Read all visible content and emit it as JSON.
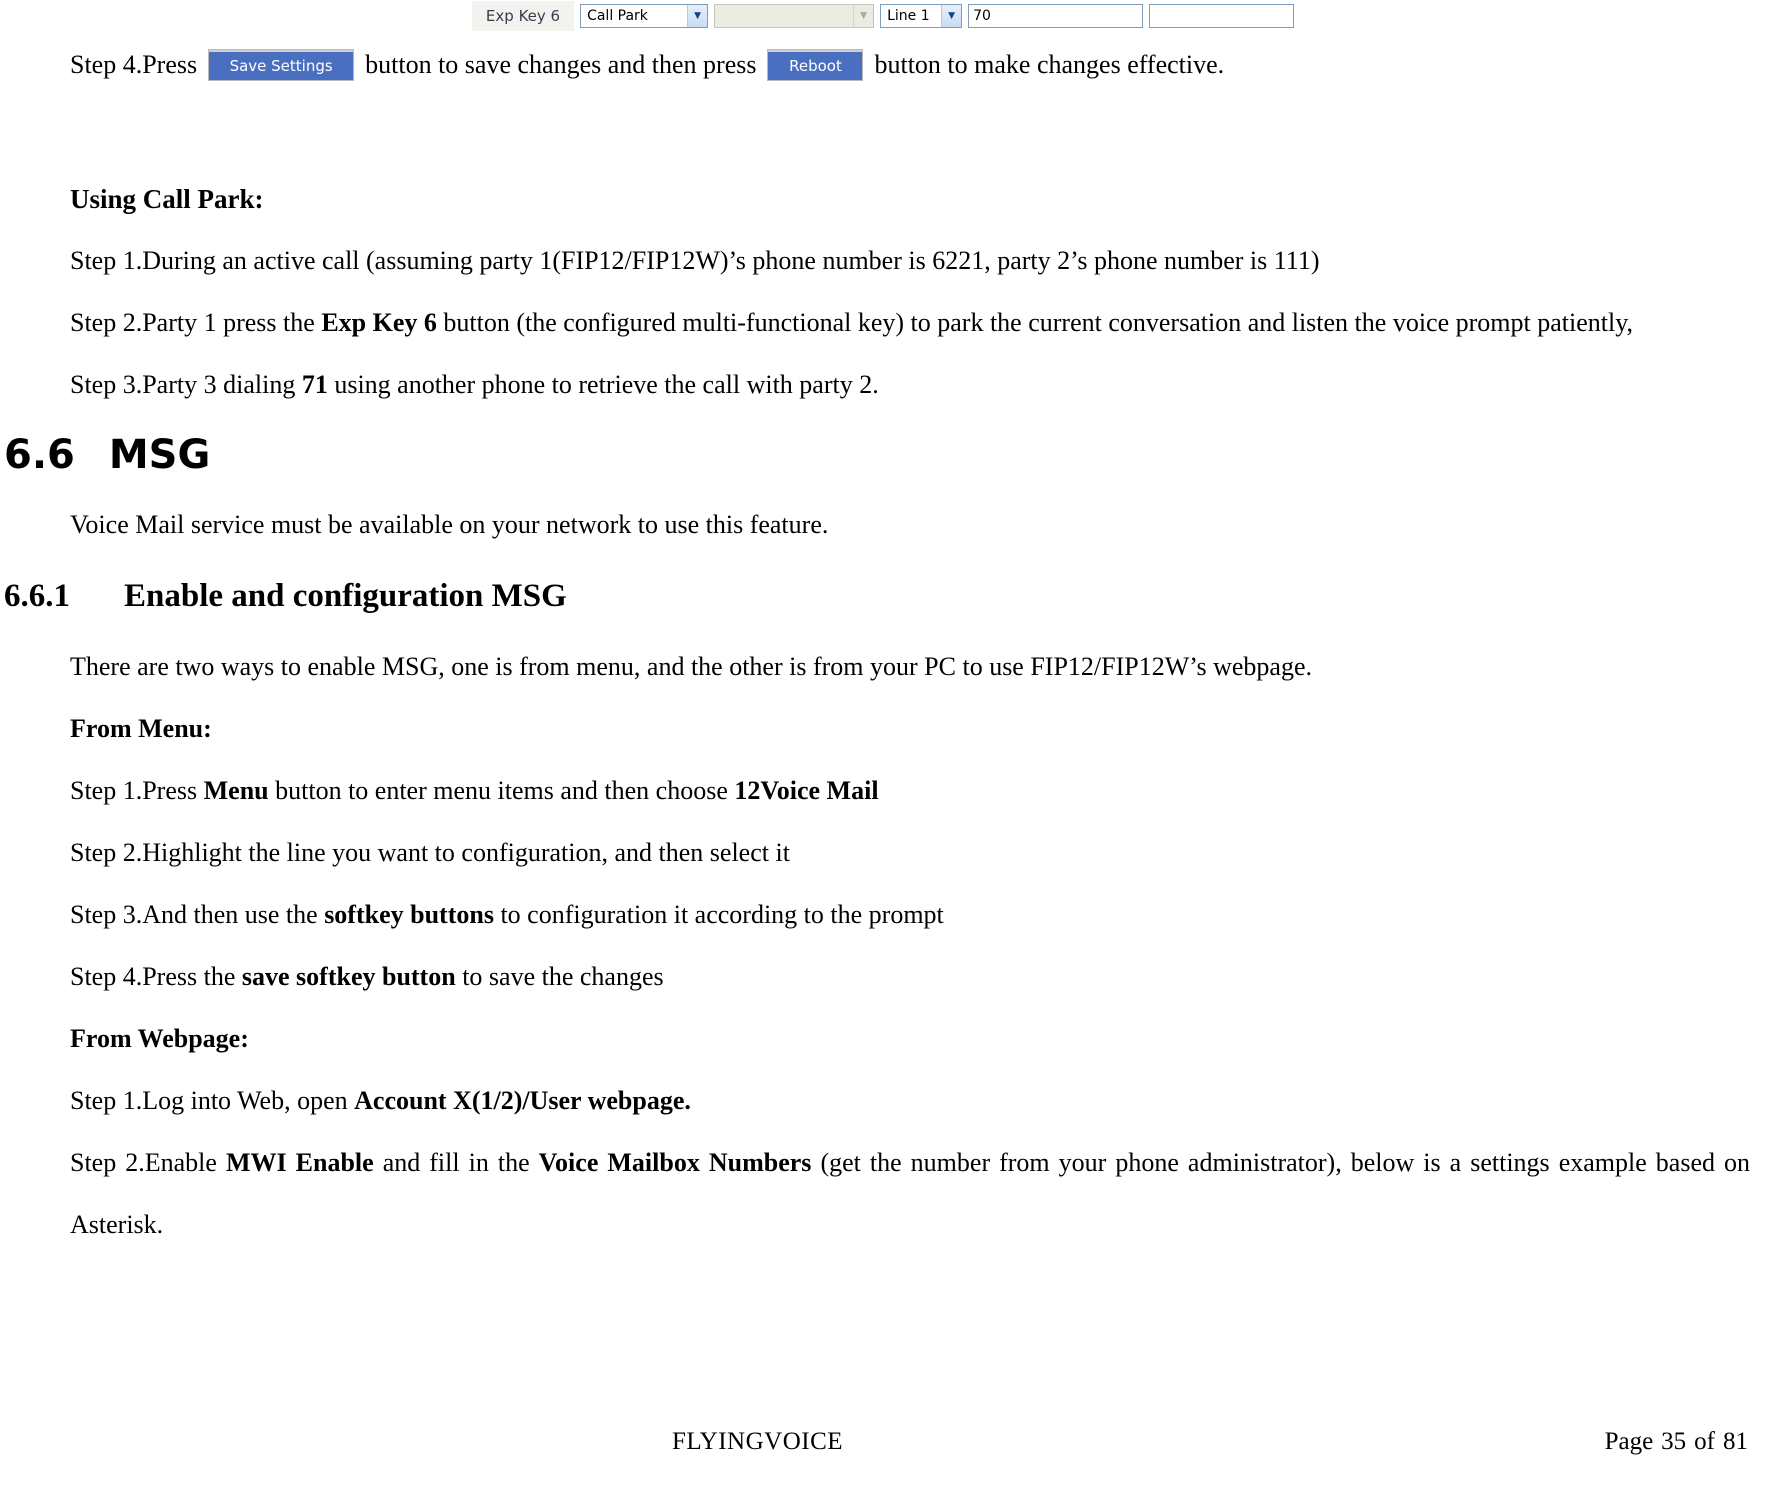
{
  "form_strip": {
    "row_label": "Exp Key 6",
    "key_type_select": {
      "value": "Call Park",
      "chevron": "chevron-down-icon"
    },
    "secondary_select": {
      "value": "",
      "chevron": "chevron-down-icon",
      "disabled": true
    },
    "line_select": {
      "value": "Line 1",
      "chevron": "chevron-down-icon"
    },
    "value_input": {
      "value": "70"
    },
    "extra_input": {
      "value": ""
    }
  },
  "step4": {
    "prefix": "Step 4.Press",
    "save_button_label": "Save Settings",
    "middle": "button to save changes and then press",
    "reboot_button_label": "Reboot",
    "suffix": "button to make changes effective.",
    "button_color": "#4a6fc0"
  },
  "using_call_park": {
    "heading": "Using Call Park:",
    "step1": "Step 1.During an active call (assuming party 1(FIP12/FIP12W)’s phone number is 6221, party 2’s phone number is 111)",
    "step2_a": "Step 2.Party 1 press the ",
    "step2_bold": "Exp Key 6",
    "step2_b": " button (the configured multi-functional key) to park the current conversation and listen the voice prompt patiently,",
    "step3_a": "Step 3.Party 3 dialing ",
    "step3_bold": "71",
    "step3_b": " using another phone to retrieve the call with party 2."
  },
  "msg_section": {
    "number": "6.6",
    "title": "MSG",
    "intro": "Voice Mail service must be available on your network to use this feature."
  },
  "msg_subsection": {
    "number": "6.6.1",
    "title": "Enable and configuration MSG",
    "intro": "There are two ways to enable MSG, one is from menu, and the other is from your PC to use FIP12/FIP12W’s webpage.",
    "from_menu_heading": "From Menu:",
    "menu_step1_a": "Step 1.Press ",
    "menu_step1_bold1": "Menu",
    "menu_step1_b": " button to enter menu items and then choose ",
    "menu_step1_bold2": "12Voice Mail",
    "menu_step2": "Step 2.Highlight the line you want to configuration, and then select it",
    "menu_step3_a": "Step 3.And then use the ",
    "menu_step3_bold": "softkey buttons",
    "menu_step3_b": " to configuration it according to the prompt",
    "menu_step4_a": "Step 4.Press the ",
    "menu_step4_bold": "save softkey button",
    "menu_step4_b": " to save the changes",
    "from_webpage_heading": "From Webpage:",
    "web_step1_a": "Step 1.Log into Web, open ",
    "web_step1_bold": "Account X(1/2)/User webpage.",
    "web_step2_a": "Step 2.Enable ",
    "web_step2_bold1": "MWI Enable",
    "web_step2_b": " and fill in the ",
    "web_step2_bold2": "Voice Mailbox Numbers",
    "web_step2_c": " (get the number from your phone administrator), below is a settings example based on Asterisk."
  },
  "footer": {
    "company": "FLYINGVOICE",
    "page_word": "Page",
    "page_number": "35",
    "of_word": "of",
    "total_pages": "81"
  }
}
